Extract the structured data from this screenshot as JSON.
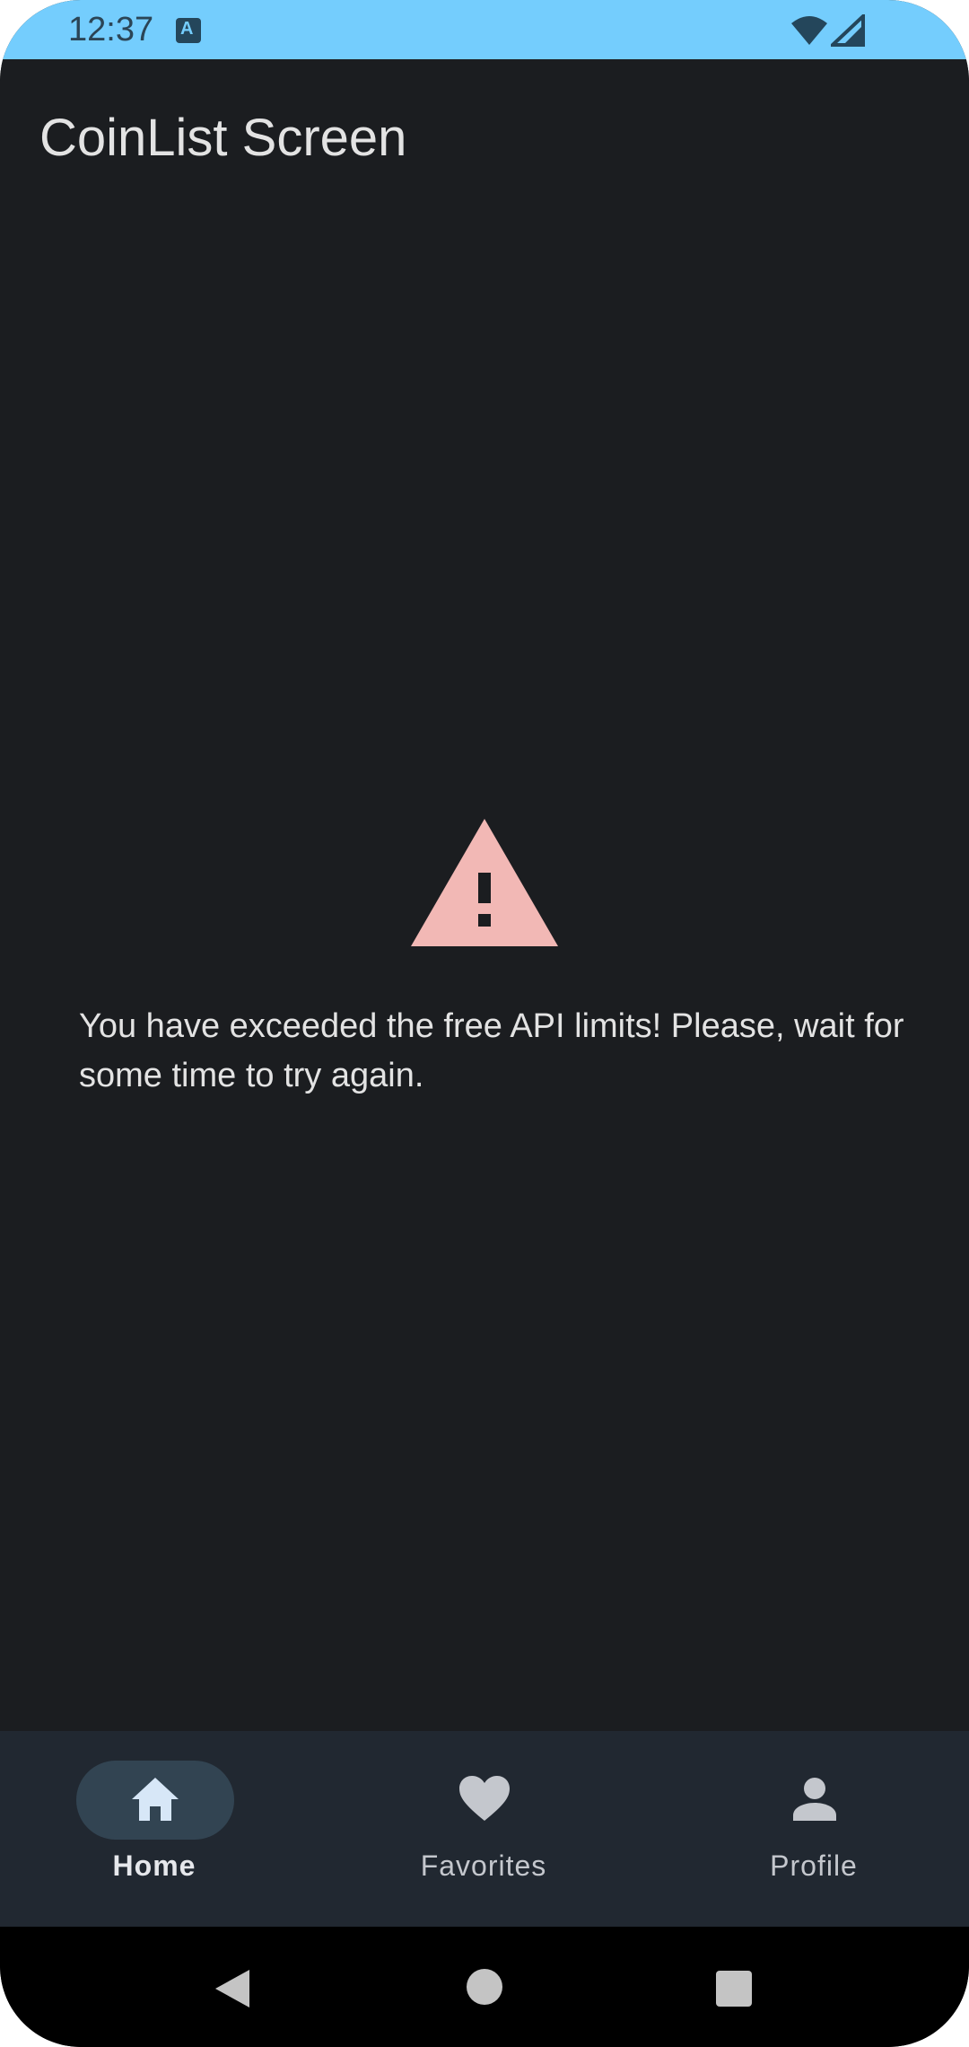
{
  "status_bar": {
    "time": "12:37",
    "notification_icon": "text-a-icon",
    "icons": [
      "wifi-icon",
      "cell-signal-icon"
    ]
  },
  "app_bar": {
    "title": "CoinList Screen"
  },
  "error": {
    "icon": "warning-icon",
    "icon_color": "#f2b8b5",
    "message": "You have exceeded the free API limits! Please, wait for some time to try again."
  },
  "bottom_nav": {
    "items": [
      {
        "label": "Home",
        "icon": "home-icon",
        "selected": true
      },
      {
        "label": "Favorites",
        "icon": "heart-icon",
        "selected": false
      },
      {
        "label": "Profile",
        "icon": "person-icon",
        "selected": false
      }
    ]
  },
  "system_nav": {
    "buttons": [
      "back-icon",
      "home-circle-icon",
      "recents-icon"
    ]
  },
  "colors": {
    "status_bar": "#74cdfd",
    "background": "#1b1d20",
    "nav_bar": "#212831",
    "selected_pill": "#324452"
  }
}
